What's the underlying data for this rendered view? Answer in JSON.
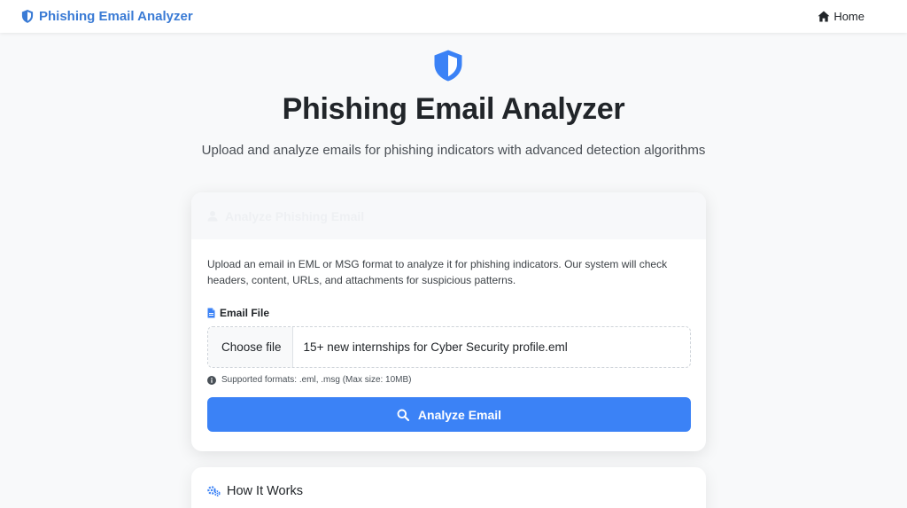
{
  "navbar": {
    "brand": "Phishing Email Analyzer",
    "home_label": "Home"
  },
  "hero": {
    "title": "Phishing Email Analyzer",
    "subtitle": "Upload and analyze emails for phishing indicators with advanced detection algorithms"
  },
  "analyze_card": {
    "header_title": "Analyze Phishing Email",
    "description": "Upload an email in EML or MSG format to analyze it for phishing indicators. Our system will check headers, content, URLs, and attachments for suspicious patterns.",
    "field_label": "Email File",
    "choose_file_label": "Choose file",
    "selected_file": "15+ new internships for Cyber Security profile.eml",
    "help_text": "Supported formats: .eml, .msg (Max size: 10MB)",
    "button_label": "Analyze Email"
  },
  "how_it_works": {
    "title": "How It Works"
  },
  "icons": {
    "brand": "shield-icon",
    "home": "home-icon",
    "header": "user-secret-icon",
    "file": "file-icon",
    "info": "info-circle-icon",
    "search": "search-icon",
    "gears": "gears-icon"
  },
  "colors": {
    "brand": "#3a7bd5",
    "primary_button": "#3b82f6",
    "background": "#f8f9fa"
  }
}
